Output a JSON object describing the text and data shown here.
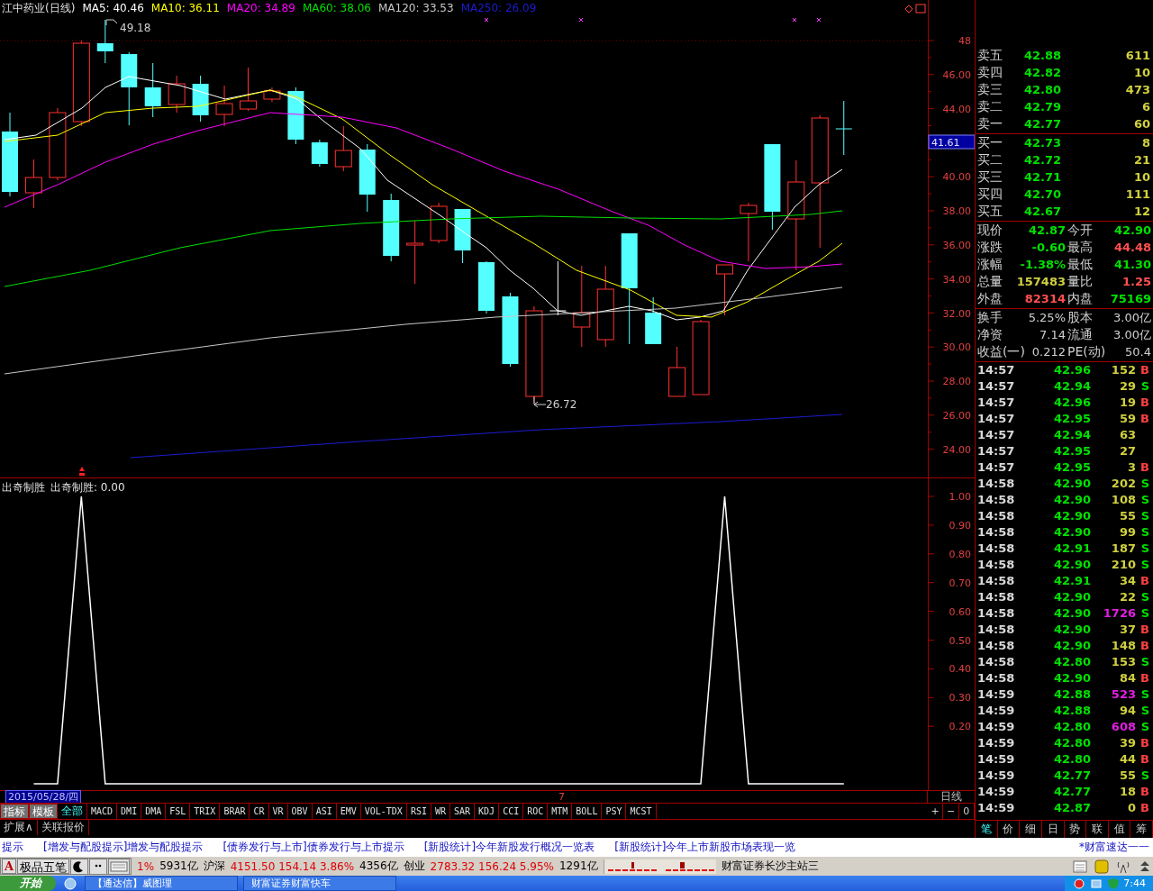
{
  "chart": {
    "title": "江中药业(日线)",
    "ma_legend": [
      {
        "label": "MA5: 40.46",
        "color": "#ffffff"
      },
      {
        "label": "MA10: 36.11",
        "color": "#ffff00"
      },
      {
        "label": "MA20: 34.89",
        "color": "#ff00ff"
      },
      {
        "label": "MA60: 38.06",
        "color": "#00e000"
      },
      {
        "label": "MA120: 33.53",
        "color": "#c8c8c8"
      },
      {
        "label": "MA250: 26.09",
        "color": "#1c1cd0"
      }
    ],
    "high_label": "49.18",
    "low_label": "26.72",
    "price_ticks": [
      "48",
      "46.00",
      "44.00",
      "40.00",
      "38.00",
      "36.00",
      "34.00",
      "32.00",
      "30.00",
      "28.00",
      "26.00",
      "24.00"
    ],
    "current_price": "41.61"
  },
  "indicator": {
    "reading": "出奇制胜: 0.00",
    "name": "出奇制胜",
    "axis_ticks": [
      "1.00",
      "0.90",
      "0.80",
      "0.70",
      "0.60",
      "0.50",
      "0.40",
      "0.30",
      "0.20"
    ]
  },
  "date_bar": {
    "date": "2015/05/28/四",
    "marker": "7"
  },
  "axis_footer": {
    "period": "日线",
    "buttons": [
      "+",
      "−",
      "0"
    ]
  },
  "toolbar": {
    "buttons": [
      "指标",
      "模板"
    ],
    "tabs": [
      {
        "label": "全部",
        "selected": true
      },
      {
        "label": "MACD",
        "selected": false
      },
      {
        "label": "DMI",
        "selected": false
      },
      {
        "label": "DMA",
        "selected": false
      },
      {
        "label": "FSL",
        "selected": false
      },
      {
        "label": "TRIX",
        "selected": false
      },
      {
        "label": "BRAR",
        "selected": false
      },
      {
        "label": "CR",
        "selected": false
      },
      {
        "label": "VR",
        "selected": false
      },
      {
        "label": "OBV",
        "selected": false
      },
      {
        "label": "ASI",
        "selected": false
      },
      {
        "label": "EMV",
        "selected": false
      },
      {
        "label": "VOL-TDX",
        "selected": false
      },
      {
        "label": "RSI",
        "selected": false
      },
      {
        "label": "WR",
        "selected": false
      },
      {
        "label": "SAR",
        "selected": false
      },
      {
        "label": "KDJ",
        "selected": false
      },
      {
        "label": "CCI",
        "selected": false
      },
      {
        "label": "ROC",
        "selected": false
      },
      {
        "label": "MTM",
        "selected": false
      },
      {
        "label": "BOLL",
        "selected": false
      },
      {
        "label": "PSY",
        "selected": false
      },
      {
        "label": "MCST",
        "selected": false
      }
    ],
    "extra": [
      "扩展∧",
      "关联报价"
    ]
  },
  "asks": [
    {
      "label": "卖五",
      "price": "42.88",
      "volume": "611"
    },
    {
      "label": "卖四",
      "price": "42.82",
      "volume": "10"
    },
    {
      "label": "卖三",
      "price": "42.80",
      "volume": "473"
    },
    {
      "label": "卖二",
      "price": "42.79",
      "volume": "6"
    },
    {
      "label": "卖一",
      "price": "42.77",
      "volume": "60"
    }
  ],
  "bids": [
    {
      "label": "买一",
      "price": "42.73",
      "volume": "8"
    },
    {
      "label": "买二",
      "price": "42.72",
      "volume": "21"
    },
    {
      "label": "买三",
      "price": "42.71",
      "volume": "10"
    },
    {
      "label": "买四",
      "price": "42.70",
      "volume": "111"
    },
    {
      "label": "买五",
      "price": "42.67",
      "volume": "12"
    }
  ],
  "quote": [
    {
      "label": "现价",
      "value": "42.87",
      "color": "#00e000"
    },
    {
      "label": "今开",
      "value": "42.90",
      "color": "#00e000"
    },
    {
      "label": "涨跌",
      "value": "-0.60",
      "color": "#00e000"
    },
    {
      "label": "最高",
      "value": "44.48",
      "color": "#ff5050"
    },
    {
      "label": "涨幅",
      "value": "-1.38%",
      "color": "#00e000"
    },
    {
      "label": "最低",
      "value": "41.30",
      "color": "#00e000"
    },
    {
      "label": "总量",
      "value": "157483",
      "color": "#d0d040"
    },
    {
      "label": "量比",
      "value": "1.25",
      "color": "#ff5050"
    },
    {
      "label": "外盘",
      "value": "82314",
      "color": "#ff5050"
    },
    {
      "label": "内盘",
      "value": "75169",
      "color": "#00e000"
    }
  ],
  "fundamentals": [
    {
      "label": "换手",
      "value": "5.25%"
    },
    {
      "label": "股本",
      "value": "3.00亿"
    },
    {
      "label": "净资",
      "value": "7.14"
    },
    {
      "label": "流通",
      "value": "3.00亿"
    },
    {
      "label": "收益(一)",
      "value": "0.212"
    },
    {
      "label": "PE(动)",
      "value": "50.4"
    }
  ],
  "trades": [
    {
      "time": "14:57",
      "price": "42.96",
      "volume": "152",
      "side": "B",
      "kind": "buy",
      "large": false
    },
    {
      "time": "14:57",
      "price": "42.94",
      "volume": "29",
      "side": "S",
      "kind": "sell",
      "large": false
    },
    {
      "time": "14:57",
      "price": "42.96",
      "volume": "19",
      "side": "B",
      "kind": "buy",
      "large": false
    },
    {
      "time": "14:57",
      "price": "42.95",
      "volume": "59",
      "side": "B",
      "kind": "buy",
      "large": false
    },
    {
      "time": "14:57",
      "price": "42.94",
      "volume": "63",
      "kind": "none",
      "large": false
    },
    {
      "time": "14:57",
      "price": "42.95",
      "volume": "27",
      "kind": "none",
      "large": false
    },
    {
      "time": "14:57",
      "price": "42.95",
      "volume": "3",
      "side": "B",
      "kind": "buy",
      "large": false
    },
    {
      "time": "14:58",
      "price": "42.90",
      "volume": "202",
      "side": "S",
      "kind": "sell",
      "large": false
    },
    {
      "time": "14:58",
      "price": "42.90",
      "volume": "108",
      "side": "S",
      "kind": "sell",
      "large": false
    },
    {
      "time": "14:58",
      "price": "42.90",
      "volume": "55",
      "side": "S",
      "kind": "sell",
      "large": false
    },
    {
      "time": "14:58",
      "price": "42.90",
      "volume": "99",
      "side": "S",
      "kind": "sell",
      "large": false
    },
    {
      "time": "14:58",
      "price": "42.91",
      "volume": "187",
      "side": "S",
      "kind": "sell",
      "large": false
    },
    {
      "time": "14:58",
      "price": "42.90",
      "volume": "210",
      "side": "S",
      "kind": "sell",
      "large": false
    },
    {
      "time": "14:58",
      "price": "42.91",
      "volume": "34",
      "side": "B",
      "kind": "buy",
      "large": false
    },
    {
      "time": "14:58",
      "price": "42.90",
      "volume": "22",
      "side": "S",
      "kind": "sell",
      "large": false
    },
    {
      "time": "14:58",
      "price": "42.90",
      "volume": "1726",
      "side": "S",
      "kind": "sell",
      "large": true
    },
    {
      "time": "14:58",
      "price": "42.90",
      "volume": "37",
      "side": "B",
      "kind": "buy",
      "large": false
    },
    {
      "time": "14:58",
      "price": "42.90",
      "volume": "148",
      "side": "B",
      "kind": "buy",
      "large": false
    },
    {
      "time": "14:58",
      "price": "42.80",
      "volume": "153",
      "side": "S",
      "kind": "sell",
      "large": false
    },
    {
      "time": "14:58",
      "price": "42.90",
      "volume": "84",
      "side": "B",
      "kind": "buy",
      "large": false
    },
    {
      "time": "14:59",
      "price": "42.88",
      "volume": "523",
      "side": "S",
      "kind": "sell",
      "large": true
    },
    {
      "time": "14:59",
      "price": "42.88",
      "volume": "94",
      "side": "S",
      "kind": "sell",
      "large": false
    },
    {
      "time": "14:59",
      "price": "42.80",
      "volume": "608",
      "side": "S",
      "kind": "sell",
      "large": true
    },
    {
      "time": "14:59",
      "price": "42.80",
      "volume": "39",
      "side": "B",
      "kind": "buy",
      "large": false
    },
    {
      "time": "14:59",
      "price": "42.80",
      "volume": "44",
      "side": "B",
      "kind": "buy",
      "large": false
    },
    {
      "time": "14:59",
      "price": "42.77",
      "volume": "55",
      "side": "S",
      "kind": "sell",
      "large": false
    },
    {
      "time": "14:59",
      "price": "42.77",
      "volume": "18",
      "side": "B",
      "kind": "buy",
      "large": false
    },
    {
      "time": "14:59",
      "price": "42.87",
      "volume": "0",
      "side": "B",
      "kind": "buy",
      "large": false
    }
  ],
  "panel_tabs": [
    {
      "label": "笔",
      "selected": true
    },
    {
      "label": "价",
      "selected": false
    },
    {
      "label": "细",
      "selected": false
    },
    {
      "label": "日",
      "selected": false
    },
    {
      "label": "势",
      "selected": false
    },
    {
      "label": "联",
      "selected": false
    },
    {
      "label": "值",
      "selected": false
    },
    {
      "label": "筹",
      "selected": false
    }
  ],
  "ticker": {
    "items": [
      "提示",
      "[增发与配股提示]增发与配股提示",
      "[债券发行与上市]债券发行与上市提示",
      "[新股统计]今年新股发行概况一览表",
      "[新股统计]今年上市新股市场表现一览"
    ],
    "brand": "*财富速达一一"
  },
  "status_bar": {
    "ime": {
      "mode": "A",
      "name": "极品五笔"
    },
    "market": [
      {
        "text": "1%",
        "kind": "up"
      },
      {
        "text": "5931亿",
        "kind": "plain"
      },
      {
        "text": "沪深",
        "kind": "plain"
      },
      {
        "text": "4151.50  154.14  3.86%",
        "kind": "up"
      },
      {
        "text": "4356亿",
        "kind": "plain"
      },
      {
        "text": "创业",
        "kind": "plain"
      },
      {
        "text": "2783.32  156.24  5.95%",
        "kind": "up"
      },
      {
        "text": "1291亿",
        "kind": "plain"
      }
    ],
    "server": "财富证券长沙主站三"
  },
  "taskbar": {
    "start": "开始",
    "tasks": [
      "【通达信】威图理",
      "财富证券财富快车"
    ],
    "clock": "7:44"
  }
}
